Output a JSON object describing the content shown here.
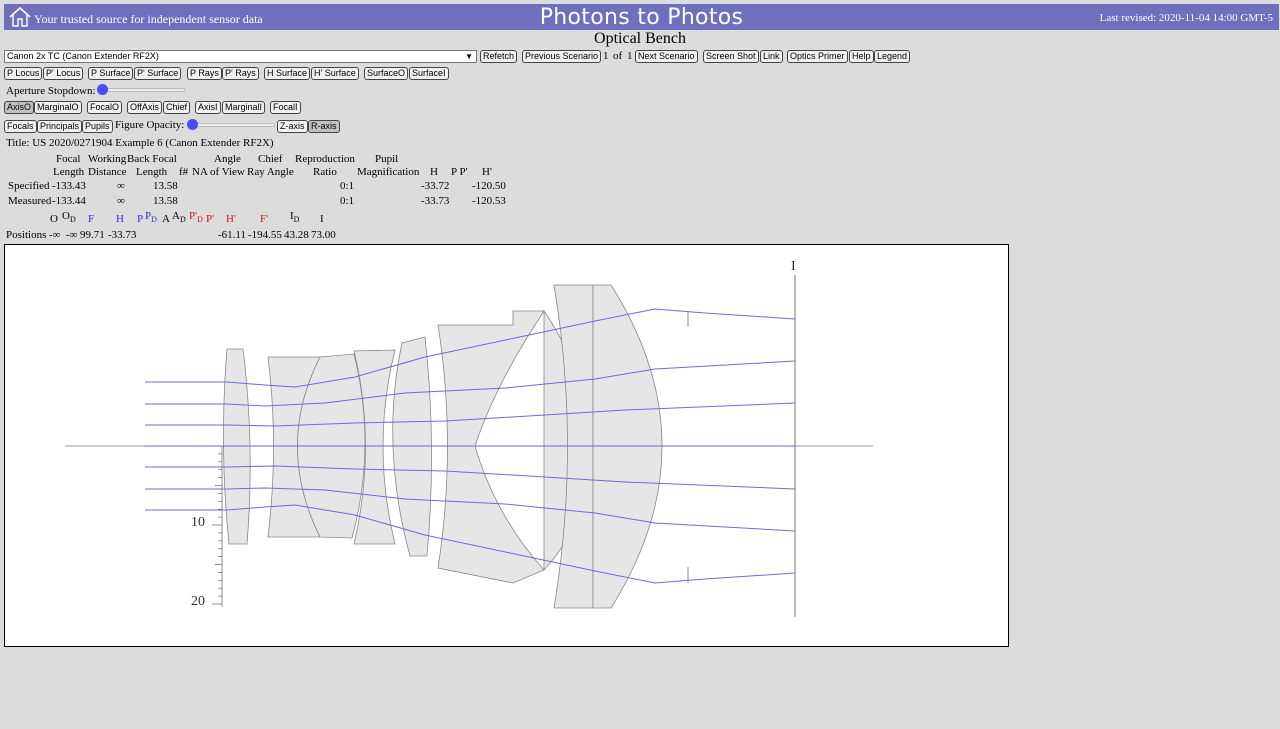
{
  "header": {
    "tagline": "Your trusted source for independent sensor data",
    "site_title": "Photons to Photos",
    "last_revised": "Last revised: 2020-11-04 14:00 GMT-5"
  },
  "page_heading": "Optical Bench",
  "scenario": {
    "selected": "Canon 2x TC (Canon Extender RF2X)",
    "refetch": "Refetch",
    "prev": "Previous Scenario",
    "index": "1",
    "of": "of",
    "total": "1",
    "next": "Next Scenario",
    "screenshot": "Screen Shot",
    "link": "Link",
    "primer": "Optics Primer",
    "help": "Help",
    "legend": "Legend"
  },
  "row2": {
    "p_locus": "P Locus",
    "pp_locus": "P' Locus",
    "p_surface": "P Surface",
    "pp_surface": "P' Surface",
    "p_rays": "P Rays",
    "pp_rays": "P' Rays",
    "h_surface": "H Surface",
    "hp_surface": "H' Surface",
    "surface_o": "SurfaceO",
    "surface_i": "SurfaceI"
  },
  "aperture_label": "Aperture Stopdown:",
  "aperture_value": 0,
  "row3": {
    "axis_o": "AxisO",
    "marginal_o": "MarginalO",
    "focal_o": "FocalO",
    "off_axis": "OffAxis",
    "chief": "Chief",
    "axis_i": "AxisI",
    "marginal_i": "MarginalI",
    "focal_i": "FocalI"
  },
  "row4": {
    "focals": "Focals",
    "principals": "Principals",
    "pupils": "Pupils",
    "opacity_label": "Figure Opacity:",
    "z_axis": "Z-axis",
    "r_axis": "R-axis"
  },
  "opacity_value": 0,
  "title_line": "Title: US 2020/0271904 Example 6 (Canon Extender RF2X)",
  "spec_table": {
    "headers": {
      "focal": "Focal",
      "length": "Length",
      "working": "Working",
      "distance": "Distance",
      "back_focal": "Back Focal",
      "length2": "Length",
      "fnum": "f#",
      "na": "NA",
      "angle": "Angle",
      "of_view": "of View",
      "chief": "Chief",
      "ray_angle": "Ray Angle",
      "reproduction": "Reproduction",
      "ratio": "Ratio",
      "pupil": "Pupil",
      "magnification": "Magnification",
      "h": "H",
      "pp": "P P'",
      "hp": "H'"
    },
    "rows": [
      {
        "label": "Specified",
        "focal": "-133.43",
        "working": "∞",
        "bfl": "13.58",
        "ratio": "0:1",
        "h": "-33.72",
        "hp": "-120.50"
      },
      {
        "label": "Measured",
        "focal": "-133.44",
        "working": "∞",
        "bfl": "13.58",
        "ratio": "0:1",
        "h": "-33.73",
        "hp": "-120.53"
      }
    ]
  },
  "positions": {
    "label": "Positions",
    "symbols": {
      "o": "O",
      "od": "O",
      "od_sub": "D",
      "f": "F",
      "h": "H",
      "p": "P",
      "pd": "P",
      "pd_sub": "D",
      "a": "A",
      "ad": "A",
      "ad_sub": "D",
      "ppd": "P'",
      "ppd_sub": "D",
      "pp": "P'",
      "hp": "H'",
      "fp": "F'",
      "id": "I",
      "id_sub": "D",
      "i": "I"
    },
    "values": {
      "o": "-∞",
      "od": "-∞",
      "f": "99.71",
      "h": "-33.73",
      "hp": "-61.11",
      "fp": "-194.55",
      "id": "43.28",
      "i": "73.00"
    }
  },
  "diagram": {
    "image_label": "I",
    "scale_labels": [
      "10",
      "20"
    ],
    "lens_fill": "#e6e6e6",
    "ray_color": "#6b6bdc"
  }
}
